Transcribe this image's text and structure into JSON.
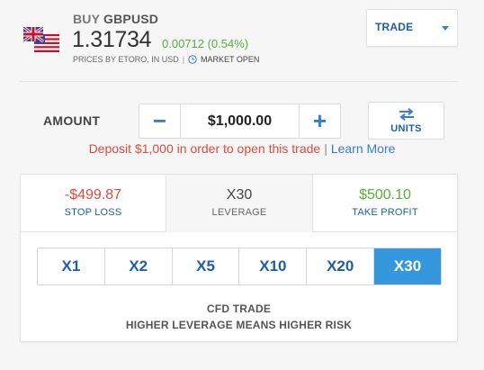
{
  "instrument": {
    "action": "BUY",
    "symbol": "GBPUSD",
    "price": "1.31734",
    "change": "0.00712 (0.54%)",
    "prices_by": "PRICES BY ETORO, IN USD",
    "separator": "|",
    "market_status": "MARKET OPEN"
  },
  "trade_dropdown": {
    "label": "TRADE"
  },
  "amount": {
    "label": "AMOUNT",
    "value": "$1,000.00",
    "minus": "−",
    "plus": "+"
  },
  "units_button": {
    "label": "UNITS"
  },
  "deposit": {
    "message": "Deposit $1,000 in order to open this trade",
    "separator": "|",
    "link": "Learn More"
  },
  "tabs": {
    "stop_loss": {
      "value": "-$499.87",
      "label": "STOP LOSS"
    },
    "leverage": {
      "value": "X30",
      "label": "LEVERAGE"
    },
    "take_profit": {
      "value": "$500.10",
      "label": "TAKE PROFIT"
    }
  },
  "leverage_options": [
    "X1",
    "X2",
    "X5",
    "X10",
    "X20",
    "X30"
  ],
  "selected_leverage": "X30",
  "footer": {
    "line1": "CFD TRADE",
    "line2": "HIGHER LEVERAGE MEANS HIGHER RISK"
  },
  "colors": {
    "accent": "#3598dc",
    "link_blue": "#1f5da8",
    "loss_red": "#e04b3c",
    "profit_green": "#5aac3c"
  }
}
